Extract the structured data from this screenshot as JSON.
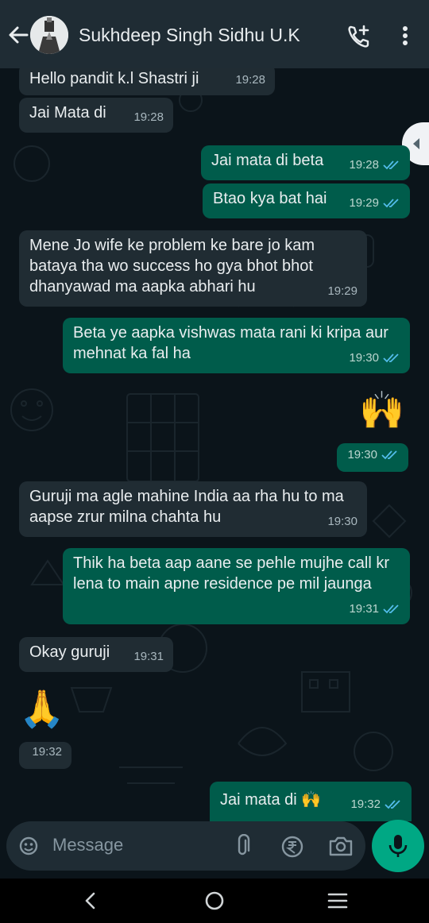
{
  "header": {
    "contact_name": "Sukhdeep Singh Sidhu U.K",
    "back_icon": "arrow-left-icon",
    "call_icon": "add-call-icon",
    "menu_icon": "more-vertical-icon"
  },
  "messages": [
    {
      "dir": "in",
      "text": "Hello pandit k.l Shastri ji",
      "time": "19:28"
    },
    {
      "dir": "in",
      "text": "Jai Mata di",
      "time": "19:28"
    },
    {
      "dir": "out",
      "text": "Jai mata di beta",
      "time": "19:28",
      "status": "read"
    },
    {
      "dir": "out",
      "text": "Btao kya bat hai",
      "time": "19:29",
      "status": "read"
    },
    {
      "dir": "in",
      "text": "Mene Jo wife ke problem ke bare jo kam bataya tha wo success ho gya bhot bhot dhanyawad ma aapka abhari hu",
      "time": "19:29"
    },
    {
      "dir": "out",
      "text": "Beta ye aapka vishwas mata rani ki kripa aur mehnat ka fal ha",
      "time": "19:30",
      "status": "read"
    },
    {
      "dir": "out",
      "text": "🙌",
      "time": "19:30",
      "status": "read"
    },
    {
      "dir": "in",
      "text": "Guruji ma agle mahine India aa rha hu to ma aapse zrur milna chahta hu",
      "time": "19:30"
    },
    {
      "dir": "out",
      "text": "Thik ha beta aap aane se pehle mujhe call kr lena to main apne residence pe mil jaunga",
      "time": "19:31",
      "status": "read"
    },
    {
      "dir": "in",
      "text": "Okay guruji",
      "time": "19:31"
    },
    {
      "dir": "in",
      "text": "🙏",
      "time": "19:32"
    },
    {
      "dir": "out",
      "text": "Jai mata di 🙌",
      "time": "19:32",
      "status": "read"
    }
  ],
  "composer": {
    "placeholder": "Message",
    "emoji_icon": "sticker-icon",
    "attach_icon": "paperclip-icon",
    "payment_icon": "rupee-icon",
    "camera_icon": "camera-icon",
    "mic_icon": "microphone-icon"
  },
  "colors": {
    "background": "#0b141a",
    "incoming": "#202c33",
    "outgoing": "#005c4b",
    "read_tick": "#53bdeb",
    "accent": "#00a884"
  }
}
